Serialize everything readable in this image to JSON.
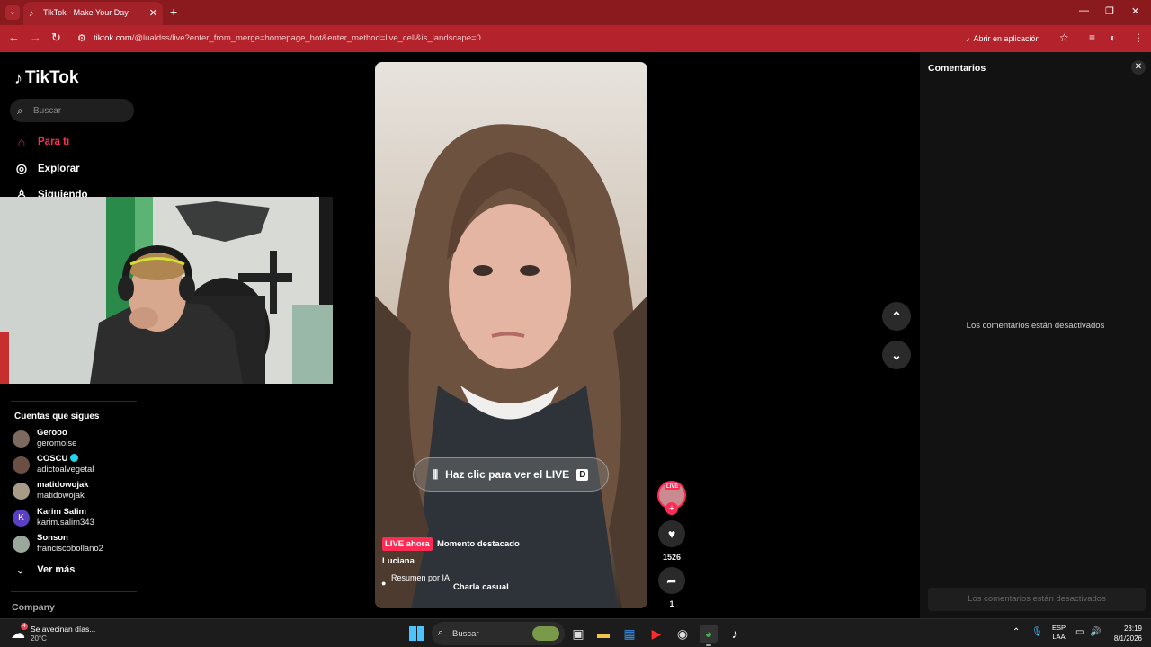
{
  "browser": {
    "tab_title": "TikTok - Make Your Day",
    "url_host": "tiktok.com",
    "url_path": "/@lualdss/live?enter_from_merge=homepage_hot&enter_method=live_cell&is_landscape=0",
    "open_in_app_label": "Abrir en aplicación",
    "theme_color": "#b4232b"
  },
  "sidebar": {
    "logo_text": "TikTok",
    "search_placeholder": "Buscar",
    "nav": {
      "for_you": "Para ti",
      "explore": "Explorar",
      "following": "Siguiendo"
    },
    "following_heading": "Cuentas que sigues",
    "accounts": [
      {
        "name": "Gerooo",
        "handle": "geromoise",
        "verified": false
      },
      {
        "name": "COSCU",
        "handle": "adictoalvegetal",
        "verified": true
      },
      {
        "name": "matidowojak",
        "handle": "matidowojak",
        "verified": false
      },
      {
        "name": "Karim Salim",
        "handle": "karim.salim343",
        "verified": false,
        "initial": "K"
      },
      {
        "name": "Sonson",
        "handle": "franciscobollano2",
        "verified": false
      }
    ],
    "see_more": "Ver más",
    "company": "Company"
  },
  "video": {
    "cta_label": "Haz clic para ver el LIVE",
    "cta_key": "D",
    "live_badge": "LIVE ahora",
    "highlight": "Momento destacado",
    "streamer": "Luciana",
    "ai_summary": "Resumen por IA",
    "topic": "Charla casual",
    "accent": "#fe2c55"
  },
  "actions": {
    "live_tag": "LIVE",
    "likes": "1526",
    "shares": "1"
  },
  "comments": {
    "title": "Comentarios",
    "disabled_message": "Los comentarios están desactivados",
    "input_placeholder": "Los comentarios están desactivados"
  },
  "taskbar": {
    "weather_title": "Se avecinan días...",
    "weather_temp": "20°C",
    "weather_badge": "4",
    "search_label": "Buscar",
    "lang_line1": "ESP",
    "lang_line2": "LAA",
    "time": "23:19",
    "date": "8/1/2026"
  }
}
